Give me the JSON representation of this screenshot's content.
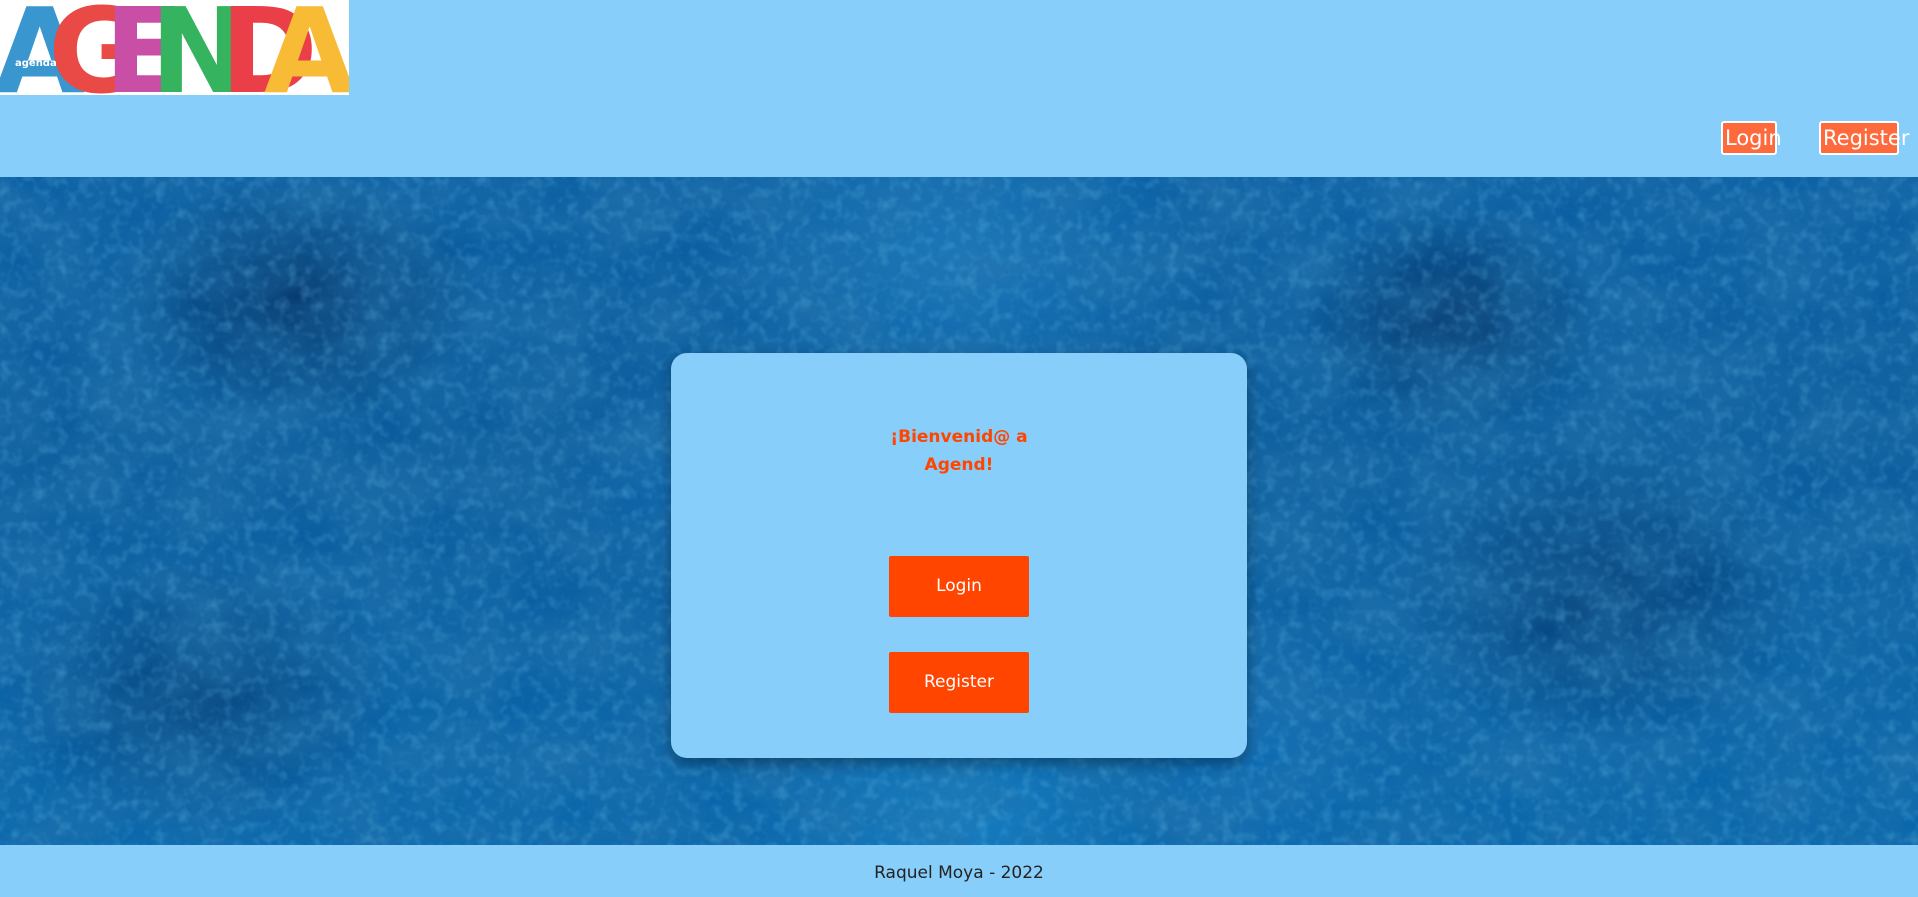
{
  "header": {
    "logo": {
      "big_text": "AGENDA",
      "small_text": "agenda",
      "letter_colors": [
        "#1e88c8",
        "#e6322c",
        "#c2379a",
        "#1aa94a",
        "#e8252f",
        "#f7b21b"
      ]
    },
    "nav": {
      "login_label": "Login",
      "register_label": "Register"
    }
  },
  "card": {
    "welcome_line1": "¡Bienvenid@ a",
    "welcome_line2": "Agend!",
    "login_label": "Login",
    "register_label": "Register"
  },
  "footer": {
    "text": "Raquel Moya - 2022"
  },
  "colors": {
    "header_bg": "#87cefa",
    "accent": "#ff4500",
    "nav_button": "#ff6a3d",
    "hero_base": "#0a5fa3"
  }
}
